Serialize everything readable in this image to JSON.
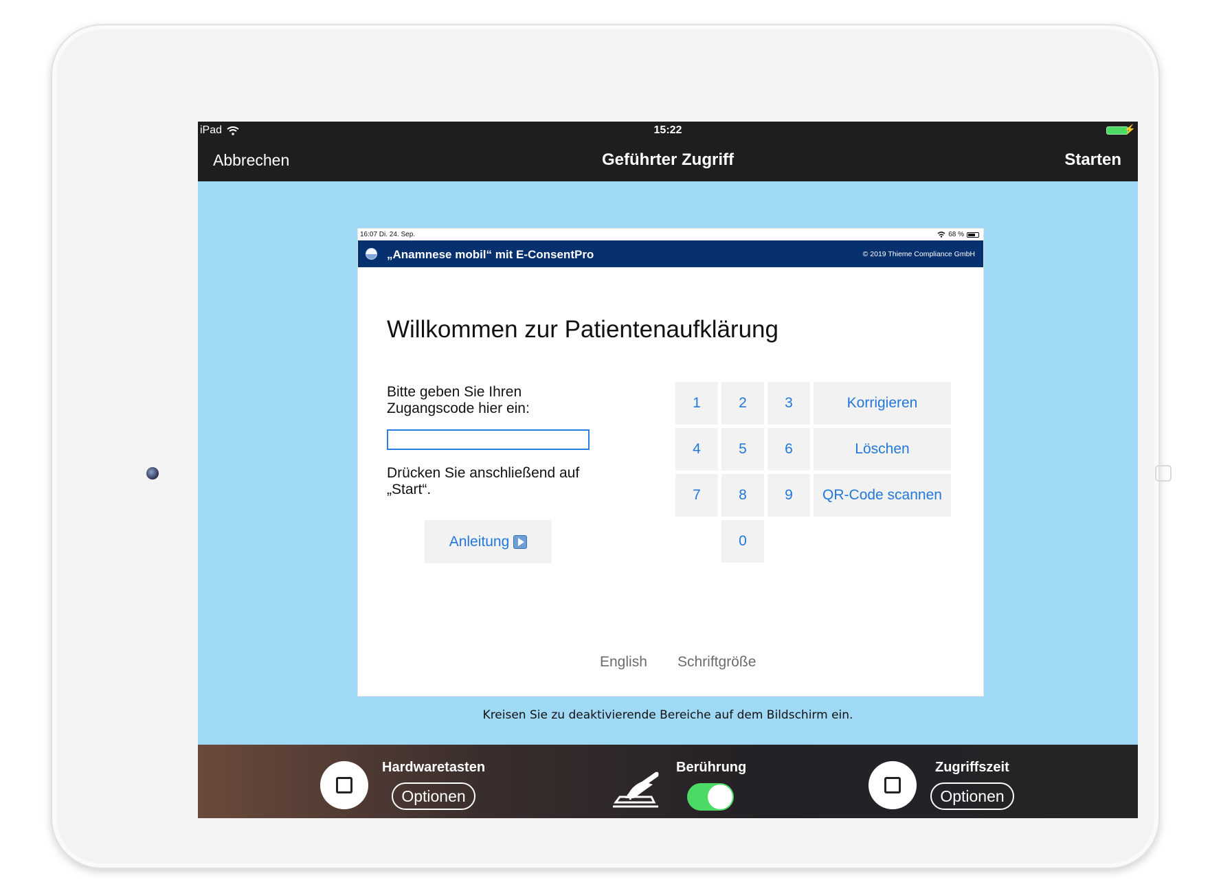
{
  "status_bar": {
    "device": "iPad",
    "time": "15:22"
  },
  "nav": {
    "cancel": "Abbrechen",
    "title": "Geführter Zugriff",
    "start": "Starten"
  },
  "app": {
    "status_time": "16:07  Di. 24. Sep.",
    "status_battery": "68 %",
    "title": "„Anamnese mobil“ mit E-ConsentPro",
    "copyright": "© 2019 Thieme Compliance GmbH",
    "welcome": "Willkommen zur Patientenaufklärung",
    "prompt": "Bitte geben Sie Ihren Zugangscode hier ein:",
    "code_value": "",
    "after_text": "Drücken Sie anschließend auf „Start“.",
    "anleitung": "Anleitung",
    "keys": [
      "1",
      "2",
      "3",
      "4",
      "5",
      "6",
      "7",
      "8",
      "9",
      "0"
    ],
    "korrigieren": "Korrigieren",
    "loeschen": "Löschen",
    "qr": "QR-Code scannen",
    "english": "English",
    "schriftgroesse": "Schriftgröße"
  },
  "hint": "Kreisen Sie zu deaktivierende Bereiche auf dem Bildschirm ein.",
  "bottom": {
    "hardware_label": "Hardwaretasten",
    "hardware_options": "Optionen",
    "touch_label": "Berührung",
    "touch_enabled": true,
    "time_label": "Zugriffszeit",
    "time_options": "Optionen"
  },
  "icons": [
    "wifi-icon",
    "battery-icon",
    "app-logo-icon",
    "play-icon",
    "touch-hand-icon",
    "square-icon"
  ],
  "colors": {
    "screen_bg": "#9fd9f6",
    "header_blue": "#07306f",
    "link_blue": "#2277dd",
    "toggle_green": "#4cd964"
  }
}
